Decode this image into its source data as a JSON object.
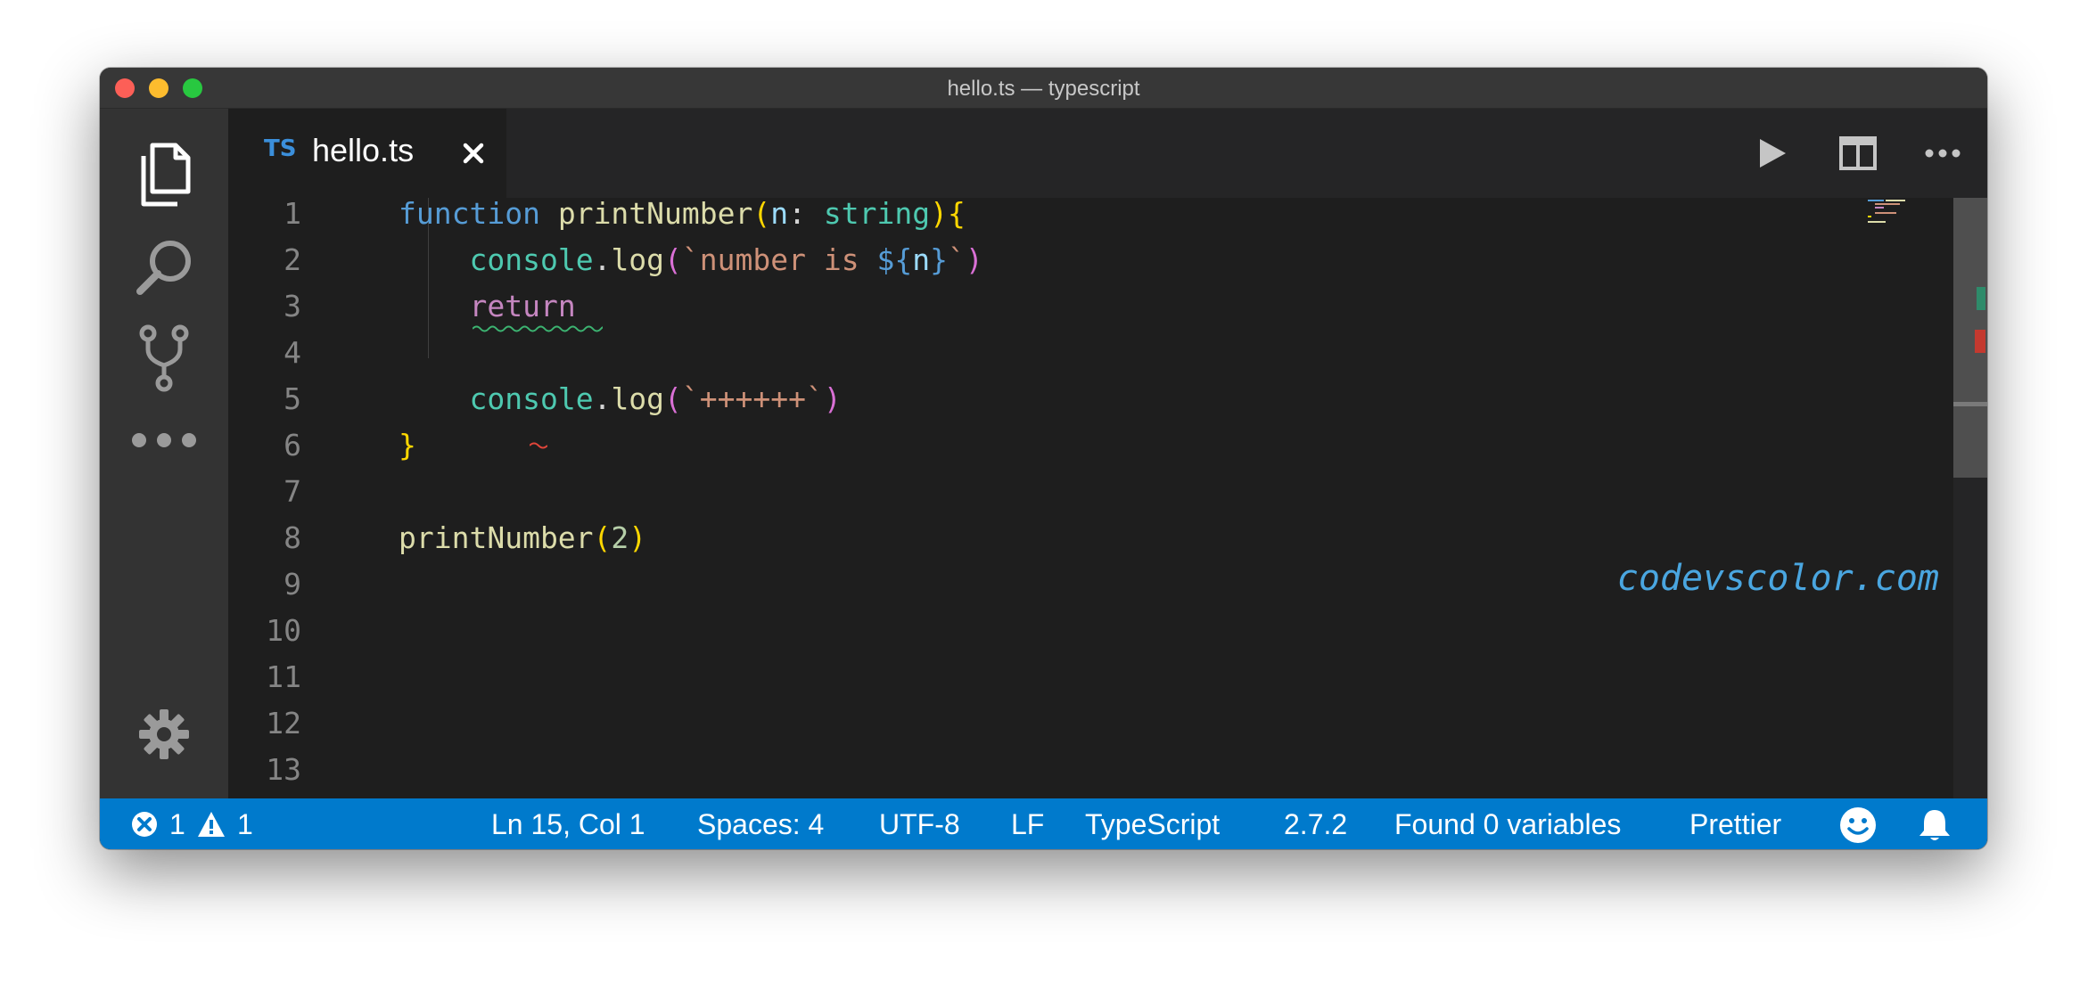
{
  "window": {
    "title": "hello.ts — typescript"
  },
  "tabs": [
    {
      "lang_badge": "TS",
      "name": "hello.ts"
    }
  ],
  "editor": {
    "line_numbers": [
      "1",
      "2",
      "3",
      "4",
      "5",
      "6",
      "7",
      "8",
      "9",
      "10",
      "11",
      "12",
      "13"
    ]
  },
  "watermark": "codevscolor.com",
  "status_bar": {
    "errors": "1",
    "warnings": "1",
    "position": "Ln 15, Col 1",
    "spaces": "Spaces: 4",
    "encoding": "UTF-8",
    "eol": "LF",
    "language": "TypeScript",
    "ts_version": "2.7.2",
    "variables": "Found 0 variables",
    "formatter": "Prettier"
  },
  "colors": {
    "status_bar_bg": "#007acc",
    "activity_bar_bg": "#333333",
    "editor_bg": "#1e1e1e"
  }
}
